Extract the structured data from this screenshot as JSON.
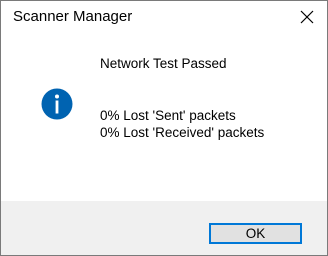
{
  "window": {
    "title": "Scanner Manager",
    "close_icon": "close-icon"
  },
  "message": {
    "icon": "info-icon",
    "icon_color": "#0063b1",
    "title": "Network Test Passed",
    "lines": [
      "0% Lost 'Sent' packets",
      "0% Lost 'Received' packets"
    ]
  },
  "buttons": {
    "ok_label": "OK",
    "ok_focus_color": "#0078d7"
  }
}
